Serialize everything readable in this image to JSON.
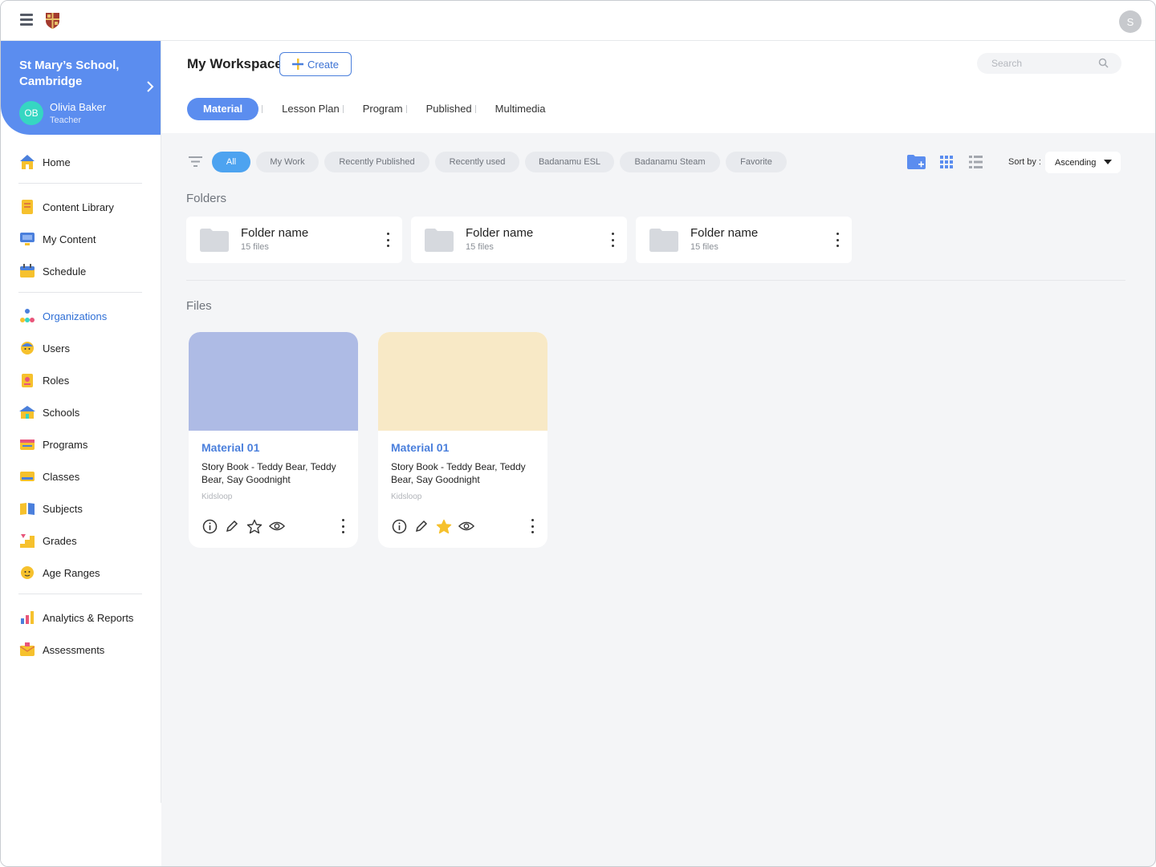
{
  "topbar": {
    "menu_icon": "hamburger-menu-icon",
    "logo_icon": "crest-logo-icon",
    "user_initial": "S"
  },
  "sidebar": {
    "org": {
      "name": "St Mary’s School, Cambridge",
      "user_initials": "OB",
      "user_name": "Olivia Baker",
      "user_role": "Teacher"
    },
    "items": [
      {
        "label": "Home",
        "icon": "home-icon"
      },
      {
        "label": "Content Library",
        "icon": "book-icon"
      },
      {
        "label": "My Content",
        "icon": "monitor-icon"
      },
      {
        "label": "Schedule",
        "icon": "calendar-icon"
      },
      {
        "label": "Organizations",
        "icon": "organization-icon"
      },
      {
        "label": "Users",
        "icon": "user-icon"
      },
      {
        "label": "Roles",
        "icon": "badge-icon"
      },
      {
        "label": "Schools",
        "icon": "school-icon"
      },
      {
        "label": "Programs",
        "icon": "program-icon"
      },
      {
        "label": "Classes",
        "icon": "class-icon"
      },
      {
        "label": "Subjects",
        "icon": "subject-book-icon"
      },
      {
        "label": "Grades",
        "icon": "stairs-icon"
      },
      {
        "label": "Age Ranges",
        "icon": "face-icon"
      },
      {
        "label": "Analytics & Reports",
        "icon": "bar-chart-icon"
      },
      {
        "label": "Assessments",
        "icon": "envelope-icon"
      }
    ],
    "active_item": "Organizations"
  },
  "header": {
    "title": "My Workspace",
    "create_label": "Create",
    "search_placeholder": "Search",
    "tabs": [
      "Material",
      "Lesson Plan",
      "Program",
      "Published",
      "Multimedia"
    ],
    "active_tab": "Material"
  },
  "filters": {
    "chips": [
      "All",
      "My Work",
      "Recently Published",
      "Recently used",
      "Badanamu ESL",
      "Badanamu Steam",
      "Favorite"
    ],
    "active_chip": "All",
    "sort_label": "Sort by :",
    "sort_value": "Ascending"
  },
  "folders_section": {
    "title": "Folders",
    "folders": [
      {
        "name": "Folder name",
        "count": "15 files"
      },
      {
        "name": "Folder name",
        "count": "15 files"
      },
      {
        "name": "Folder name",
        "count": "15 files"
      }
    ]
  },
  "files_section": {
    "title": "Files",
    "files": [
      {
        "title": "Material 01",
        "description": "Story Book - Teddy Bear, Teddy Bear, Say Goodnight",
        "author": "Kidsloop",
        "thumb_color": "#aebbe5",
        "favorited": false
      },
      {
        "title": "Material 01",
        "description": "Story Book - Teddy Bear, Teddy Bear, Say Goodnight",
        "author": "Kidsloop",
        "thumb_color": "#f8e9c6",
        "favorited": true
      }
    ]
  },
  "colors": {
    "accent": "#5b8def",
    "chip_active": "#4da3f0",
    "star_active": "#f6c12d"
  }
}
